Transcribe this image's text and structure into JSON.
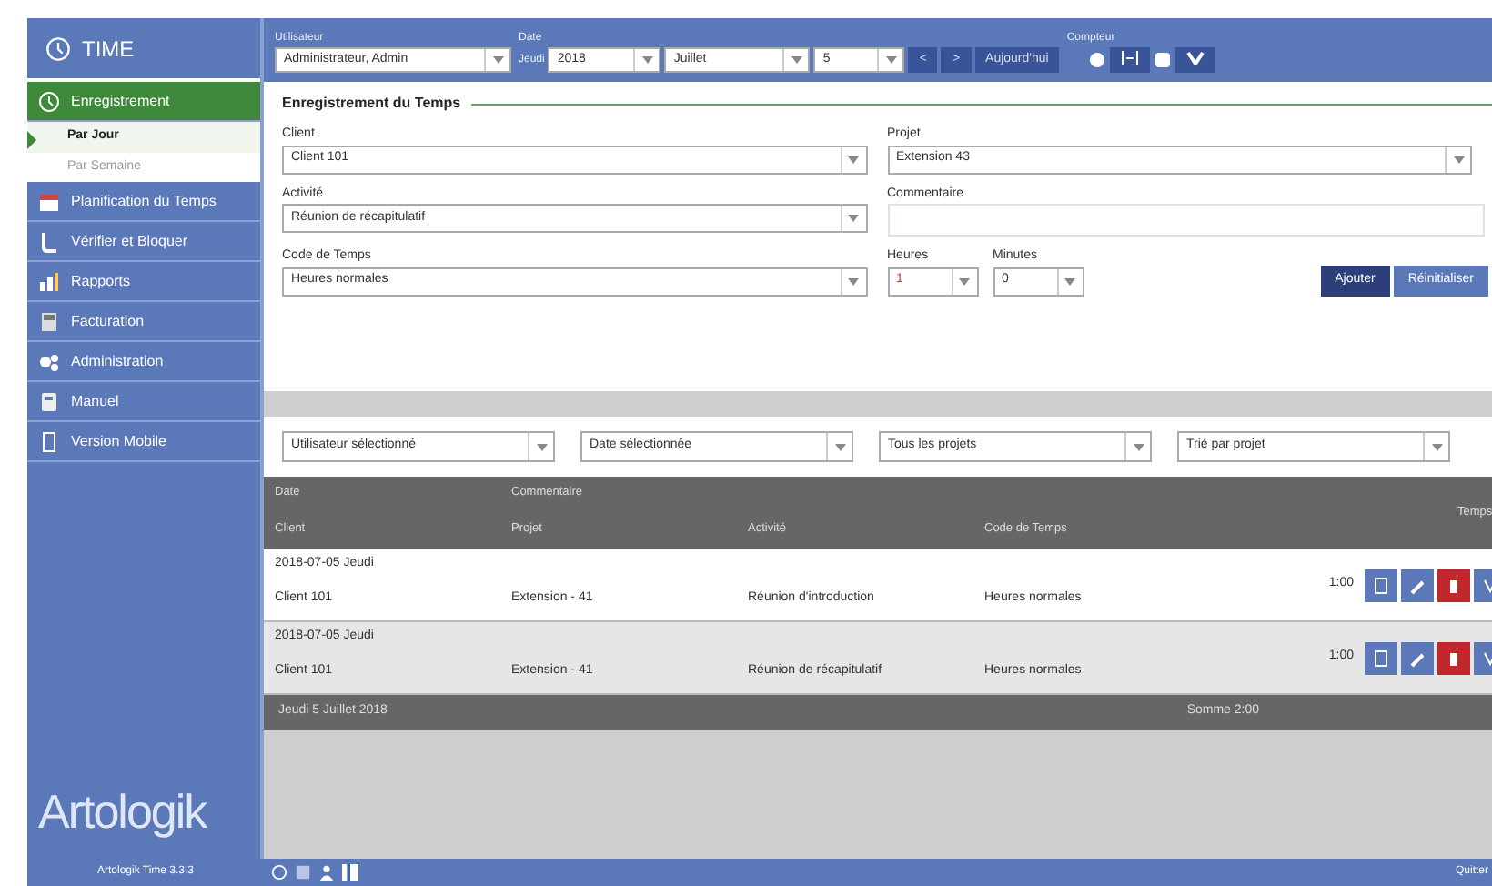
{
  "sidebar": {
    "title": "TIME",
    "items": [
      {
        "label": "Enregistrement",
        "selected": true,
        "children": [
          {
            "label": "Par Jour",
            "selected": true
          },
          {
            "label": "Par Semaine",
            "selected": false
          }
        ]
      },
      {
        "label": "Planification du Temps",
        "selected": false
      },
      {
        "label": "Vérifier et Bloquer",
        "selected": false
      },
      {
        "label": "Rapports",
        "selected": false
      },
      {
        "label": "Facturation",
        "selected": false
      },
      {
        "label": "Administration",
        "selected": false
      },
      {
        "label": "Manuel",
        "selected": false
      },
      {
        "label": "Version Mobile",
        "selected": false
      }
    ],
    "logo": "Artologik",
    "footer": "Artologik Time 3.3.3"
  },
  "topbar": {
    "user_label": "Utilisateur",
    "user": "Administrateur, Admin",
    "date_label": "Date",
    "weekday": "Jeudi",
    "year": "2018",
    "month": "Juillet",
    "day": "5",
    "prev": "<",
    "next": ">",
    "today": "Aujourd'hui",
    "counter_label": "Compteur"
  },
  "form": {
    "title": "Enregistrement du Temps",
    "fields": [
      {
        "label": "Client",
        "value": "Client 101",
        "kind": "select"
      },
      {
        "label": "Projet",
        "value": "Extension 43",
        "kind": "select"
      },
      {
        "label": "Activité",
        "value": "Réunion de récapitulatif",
        "kind": "select"
      },
      {
        "label": "Commentaire",
        "kind": "text"
      },
      {
        "label": "Code de Temps",
        "value": "Heures normales",
        "kind": "select"
      }
    ],
    "hours_label": "Heures",
    "hours": "1",
    "minutes_label": "Minutes",
    "minutes": "0",
    "add": "Ajouter",
    "reset": "Réinitialiser"
  },
  "filters": [
    "Utilisateur sélectionné",
    "Date sélectionnée",
    "Tous les projets",
    "Trié par projet"
  ],
  "table": {
    "columns": {
      "date": "Date",
      "comment": "Commentaire",
      "client": "Client",
      "project": "Projet",
      "activity": "Activité",
      "code": "Code de Temps",
      "time": "Temps"
    },
    "rows": [
      {
        "date": "2018-07-05 Jeudi",
        "client": "Client 101",
        "project": "Extension - 41",
        "activity": "Réunion d'introduction",
        "code": "Heures normales",
        "time": "1:00"
      },
      {
        "date": "2018-07-05 Jeudi",
        "client": "Client 101",
        "project": "Extension - 41",
        "activity": "Réunion de récapitulatif",
        "code": "Heures normales",
        "time": "1:00"
      }
    ],
    "footer_date": "Jeudi 5 Juillet 2018",
    "footer_sum": "Somme 2:00"
  },
  "status_bar": {
    "right": "Quitter"
  }
}
